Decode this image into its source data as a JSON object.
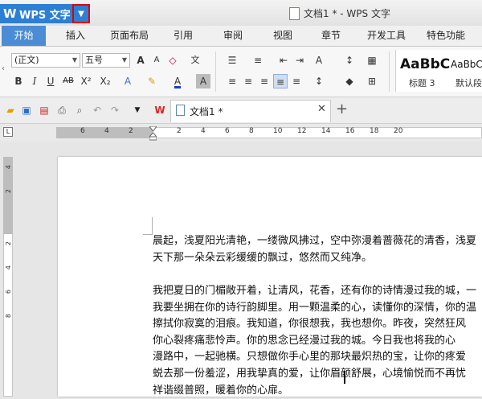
{
  "app": {
    "name": "WPS 文字",
    "window_title": "文档1 * - WPS 文字"
  },
  "menu_tabs": [
    {
      "label": "开始",
      "active": true
    },
    {
      "label": "插入"
    },
    {
      "label": "页面布局"
    },
    {
      "label": "引用"
    },
    {
      "label": "审阅"
    },
    {
      "label": "视图"
    },
    {
      "label": "章节"
    },
    {
      "label": "开发工具"
    },
    {
      "label": "特色功能"
    }
  ],
  "ribbon": {
    "font_name": "(正文)",
    "font_size": "五号",
    "style_sample_1": "AaBbC",
    "style_sample_2": "AaBbC",
    "style_label_1": "标题 3",
    "style_label_2": "默认段",
    "accent_color": "#4b8dd5",
    "font_color": "#1f3fbf"
  },
  "document_tab": {
    "label": "文档1 *"
  },
  "ruler": {
    "top_ticks": [
      "6",
      "4",
      "2",
      "2",
      "4",
      "6",
      "8",
      "10",
      "12",
      "14",
      "16",
      "18",
      "20"
    ],
    "left_ticks": [
      "4",
      "2",
      "2",
      "4",
      "6",
      "8"
    ]
  },
  "document": {
    "paragraphs": [
      [
        "晨起，浅夏阳光清艳，一缕微风拂过，空中弥漫着蔷薇花的清香，浅夏",
        "天下那一朵朵云彩缓缓的飘过，悠然而又纯净。"
      ],
      [
        "我把夏日的门楣敞开着，让清风，花香，还有你的诗情漫过我的城，一",
        "我要坐拥在你的诗行韵脚里。用一颗温柔的心，读懂你的深情，你的温",
        "擦拭你寂寞的泪痕。我知道，你很想我，我也想你。昨夜，突然狂风",
        "你心裂疼痛悲怜声。你的思念已经漫过我的城。今日我也将我的心",
        "漫路中，一起驰横。只想做你手心里的那块最炽热的宝，让你的疼爱",
        "蜕去那一份羞涩，用我挚真的爱，让你眉颜舒展，心境愉悦而不再忧",
        "祥谐缀普照，暖着你的心扉。"
      ]
    ]
  }
}
